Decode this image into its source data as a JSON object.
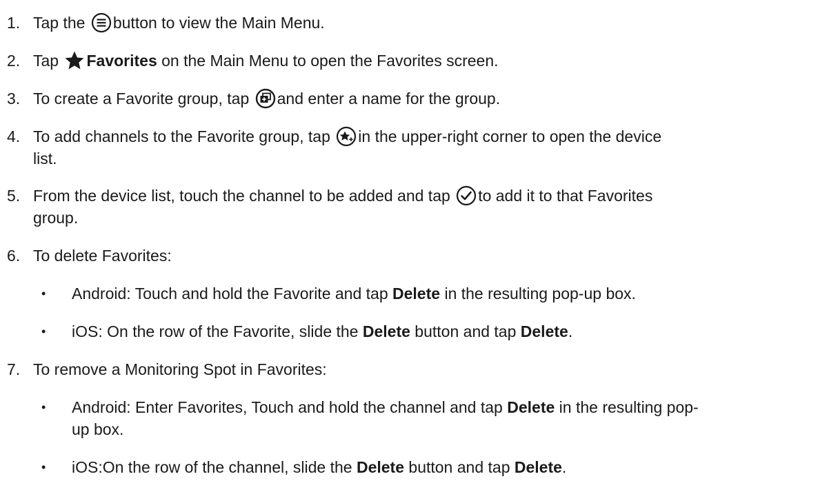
{
  "steps": [
    {
      "number": "1.",
      "before": "Tap the ",
      "icon": "menu-circle-icon",
      "after": "button to view the Main Menu."
    },
    {
      "number": "2.",
      "before": "Tap ",
      "icon": "star-icon",
      "bold": "Favorites",
      "after": " on the Main Menu to open the Favorites screen."
    },
    {
      "number": "3.",
      "before": "To create a Favorite group, tap ",
      "icon": "add-group-icon",
      "after": "and enter a name for the group."
    },
    {
      "number": "4.",
      "before": "To add channels to the Favorite group, tap ",
      "icon": "add-favorite-icon",
      "after": "in the upper-right corner to open the device",
      "continuation": "list."
    },
    {
      "number": "5.",
      "before": "From the device list, touch the channel to be added and tap ",
      "icon": "checkmark-circle-icon",
      "after": "to add it to that Favorites",
      "continuation": "group."
    },
    {
      "number": "6.",
      "text": "To delete Favorites:",
      "bullets": [
        {
          "before": "Android: Touch and hold the Favorite and tap ",
          "bold": "Delete",
          "after": " in the resulting pop-up box."
        },
        {
          "before": "iOS: On the row of the Favorite, slide the ",
          "bold": "Delete",
          "middle": " button and tap ",
          "bold2": "Delete",
          "after": "."
        }
      ]
    },
    {
      "number": "7.",
      "text": "To remove a Monitoring Spot in Favorites:",
      "bullets": [
        {
          "before": "Android: Enter Favorites, Touch and hold the channel and tap ",
          "bold": "Delete",
          "after": " in the resulting pop-",
          "continuation": "up box."
        },
        {
          "before": "iOS:On the row of the channel, slide the ",
          "bold": "Delete",
          "middle": " button and tap ",
          "bold2": "Delete",
          "after": "."
        }
      ]
    }
  ],
  "bullet_glyph": "•"
}
